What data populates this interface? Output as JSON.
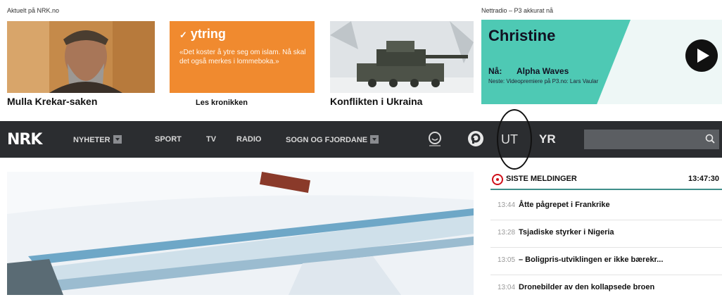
{
  "promos": {
    "section_label": "Aktuelt på NRK.no",
    "items": [
      {
        "caption": "Mulla Krekar-saken"
      },
      {
        "brand": "ytring",
        "quote": "«Det koster å ytre seg om islam. Nå skal det også merkes i lommeboka.»",
        "caption": "Les kronikken"
      },
      {
        "caption": "Konflikten i Ukraina"
      }
    ]
  },
  "radio": {
    "section_label": "Nettradio – P3 akkurat nå",
    "host": "Christine",
    "now_label": "Nå:",
    "now_song": "Alpha Waves",
    "next": "Neste: Videopremiere på P3.no: Lars Vaular"
  },
  "nav": {
    "logo": "NRK",
    "items": [
      "NYHETER",
      "SPORT",
      "TV",
      "RADIO",
      "SOGN OG FJORDANE"
    ],
    "ut": "UT",
    "yr": "YR",
    "search_placeholder": ""
  },
  "news": {
    "title": "SISTE MELDINGER",
    "time": "13:47:30",
    "rows": [
      {
        "time": "13:44",
        "text": "Åtte pågrepet i Frankrike"
      },
      {
        "time": "13:28",
        "text": "Tsjadiske styrker i Nigeria"
      },
      {
        "time": "13:05",
        "text": "– Boligpris-utviklingen er ikke bærekr..."
      },
      {
        "time": "13:04",
        "text": "Dronebilder av den kollapsede broen"
      }
    ]
  },
  "colors": {
    "nav_bg": "#2b2d30",
    "ytring_orange": "#f08a2f",
    "radio_teal": "#4ec9b4",
    "news_accent": "#3f8f8a",
    "live_red": "#d0101a"
  }
}
